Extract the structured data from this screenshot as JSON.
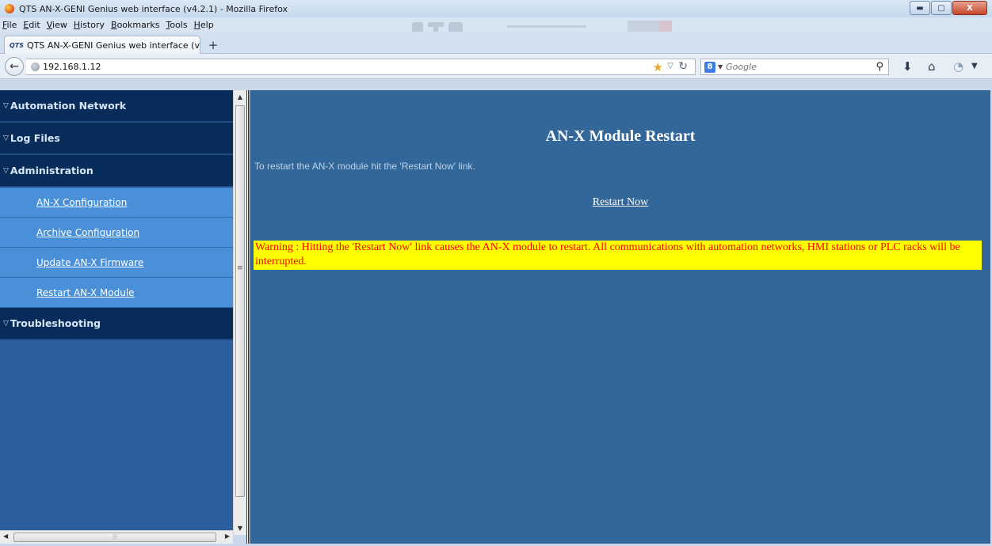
{
  "window": {
    "title": "QTS AN-X-GENI Genius web interface (v4.2.1) - Mozilla Firefox",
    "buttons": {
      "minimize": "▬",
      "maximize": "▢",
      "close": "X"
    }
  },
  "menubar": [
    "File",
    "Edit",
    "View",
    "History",
    "Bookmarks",
    "Tools",
    "Help"
  ],
  "tab": {
    "favicon": "QTS",
    "title": "QTS AN-X-GENI Genius web interface (v...",
    "new_tab": "+"
  },
  "navbar": {
    "back": "←",
    "url": "192.168.1.12",
    "search": {
      "engine": "8",
      "placeholder": "Google"
    }
  },
  "sidebar": {
    "sections": [
      {
        "label": "Automation Network"
      },
      {
        "label": "Log Files"
      },
      {
        "label": "Administration"
      },
      {
        "label": "Troubleshooting"
      }
    ],
    "admin_items": [
      {
        "label": "AN-X Configuration"
      },
      {
        "label": "Archive Configuration"
      },
      {
        "label": "Update AN-X Firmware"
      },
      {
        "label": "Restart AN-X Module"
      }
    ]
  },
  "main": {
    "title": "AN-X Module Restart",
    "intro": "To restart the AN-X module hit the 'Restart Now' link.",
    "restart_link": "Restart Now",
    "warning": "Warning : Hitting the 'Restart Now' link causes the AN-X module to restart. All communications with automation networks, HMI stations or PLC racks will be interrupted."
  },
  "colors": {
    "content_bg": "#336699",
    "sidebar_section_bg": "#082c5a",
    "sidebar_item_bg": "#4a90d9",
    "warning_bg": "#ffff00",
    "warning_text": "#ff0000"
  }
}
